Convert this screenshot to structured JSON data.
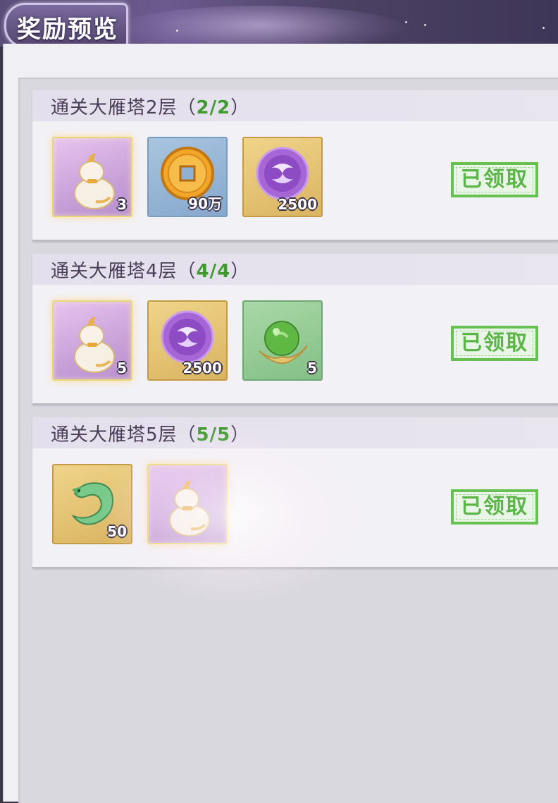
{
  "header": {
    "title": "奖励预览"
  },
  "cards": [
    {
      "title": "通关大雁塔2层（",
      "progress": "2/2",
      "close": "）",
      "items": [
        {
          "icon": "gourd-icon",
          "qty": "3"
        },
        {
          "icon": "copper-coin-icon",
          "qty": "90万"
        },
        {
          "icon": "purple-swirl-orb-icon",
          "qty": "2500"
        }
      ],
      "status": "已领取"
    },
    {
      "title": "通关大雁塔4层（",
      "progress": "4/4",
      "close": "）",
      "items": [
        {
          "icon": "gourd-icon",
          "qty": "5"
        },
        {
          "icon": "purple-swirl-orb-icon",
          "qty": "2500"
        },
        {
          "icon": "jade-bead-icon",
          "qty": "5"
        }
      ],
      "status": "已领取"
    },
    {
      "title": "通关大雁塔5层（",
      "progress": "5/5",
      "close": "）",
      "items": [
        {
          "icon": "jade-dragon-icon",
          "qty": "50"
        },
        {
          "icon": "gourd-icon",
          "qty": ""
        }
      ],
      "status": "已领取"
    }
  ],
  "colors": {
    "progress_green": "#3f9a2f",
    "claimed_green": "#5cb548",
    "title_text": "#4b3e58"
  }
}
